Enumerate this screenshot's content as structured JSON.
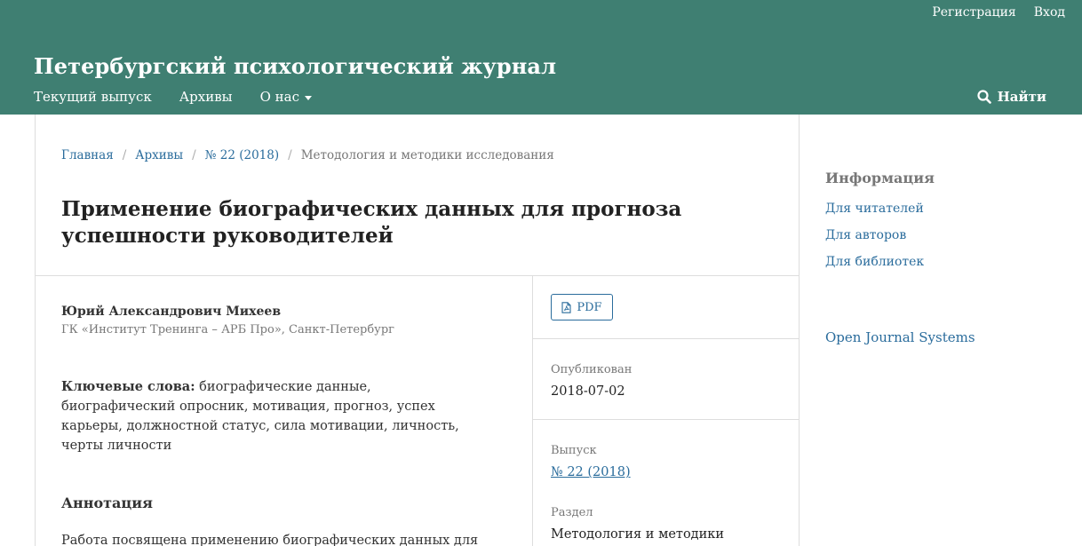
{
  "user_nav": {
    "register": "Регистрация",
    "login": "Вход"
  },
  "site": {
    "title": "Петербургский психологический журнал"
  },
  "primary_nav": {
    "current_issue": "Текущий выпуск",
    "archives": "Архивы",
    "about": "О нас",
    "search": "Найти"
  },
  "breadcrumb": {
    "home": "Главная",
    "archives": "Архивы",
    "issue": "№ 22 (2018)",
    "current": "Методология и методики исследования"
  },
  "article": {
    "title": "Применение биографических данных для прогноза успешности руководителей",
    "author": "Юрий Александрович Михеев",
    "affiliation": "ГК «Институт Тренинга – АРБ Про», Санкт-Петербург",
    "keywords_label": "Ключевые слова:",
    "keywords": "биографические данные, биографический опросник, мотивация, прогноз, успех карьеры, должностной статус, сила мотивации, личность, черты личности",
    "abstract_title": "Аннотация",
    "abstract_text": "Работа посвящена применению биографических данных для"
  },
  "details": {
    "pdf_label": "PDF",
    "published_label": "Опубликован",
    "published_date": "2018-07-02",
    "issue_label": "Выпуск",
    "issue_value": "№ 22 (2018)",
    "section_label": "Раздел",
    "section_value": "Методология и методики"
  },
  "sidebar": {
    "title": "Информация",
    "links": [
      "Для читателей",
      "Для авторов",
      "Для библиотек"
    ],
    "ojs": "Open Journal Systems"
  },
  "colors": {
    "header_bg": "#3f7f72",
    "link": "#2a6c9c"
  }
}
